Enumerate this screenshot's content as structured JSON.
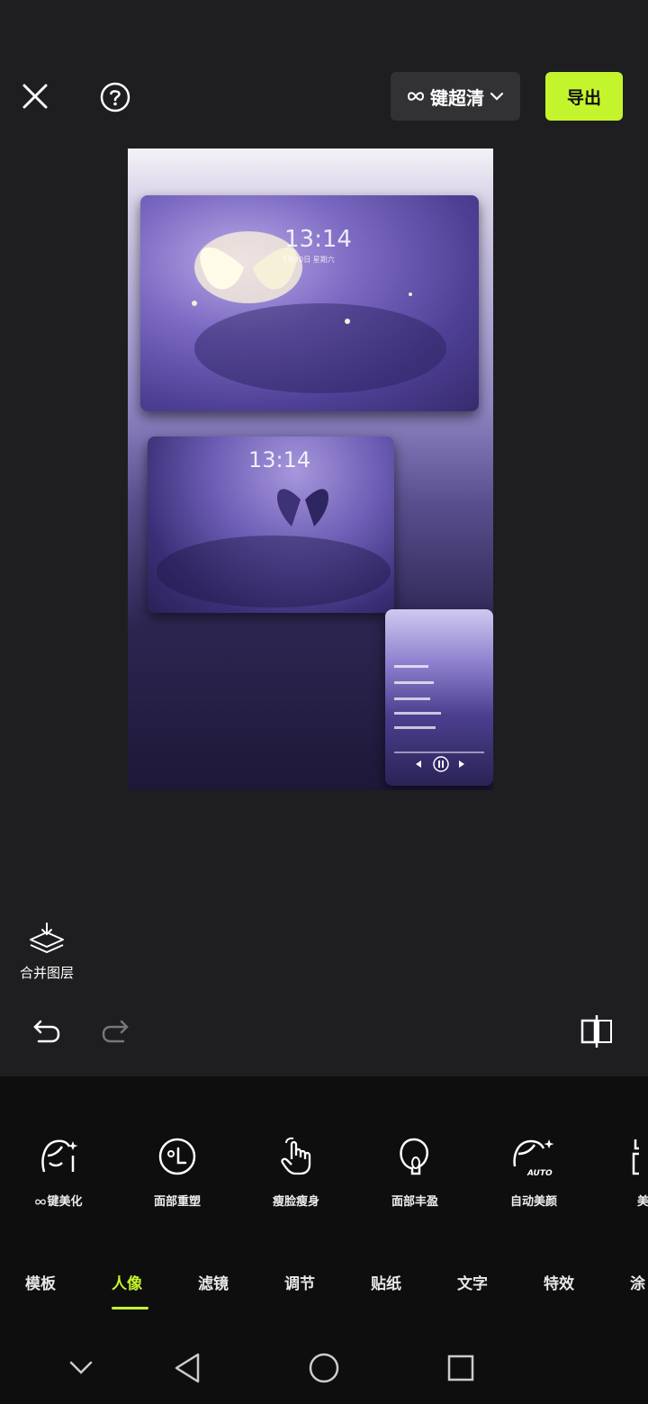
{
  "topbar": {
    "close_icon": "close-icon",
    "help_icon": "help-icon",
    "quality_label": "键超清",
    "export_label": "导出"
  },
  "canvas": {
    "card1": {
      "time": "13:14",
      "date": "5月20日 星期六"
    },
    "card2": {
      "time": "13:14"
    },
    "card3": {
      "lines": [
        "",
        "",
        "",
        "",
        ""
      ]
    }
  },
  "merge_layer_label": "合并图层",
  "tools": [
    {
      "label": "键美化",
      "icon": "face-beautify-icon"
    },
    {
      "label": "面部重塑",
      "icon": "face-reshape-icon"
    },
    {
      "label": "瘦脸瘦身",
      "icon": "slim-hand-icon"
    },
    {
      "label": "面部丰盈",
      "icon": "face-plump-icon"
    },
    {
      "label": "自动美颜",
      "icon": "auto-beauty-icon"
    },
    {
      "label": "美",
      "icon": "lipstick-icon"
    }
  ],
  "tabs": [
    {
      "label": "模板"
    },
    {
      "label": "人像"
    },
    {
      "label": "滤镜"
    },
    {
      "label": "调节"
    },
    {
      "label": "贴纸"
    },
    {
      "label": "文字"
    },
    {
      "label": "特效"
    },
    {
      "label": "涂"
    }
  ],
  "active_tab": "人像",
  "colors": {
    "accent": "#c4f52c",
    "background": "#1e1e20",
    "panel": "#0e0e0f"
  }
}
